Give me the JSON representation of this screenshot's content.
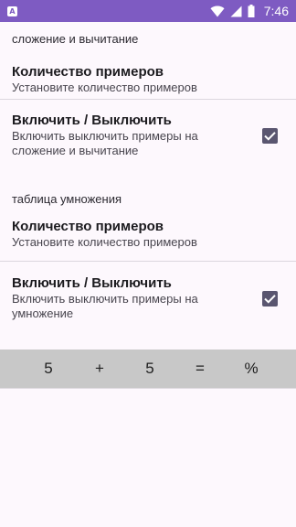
{
  "status_bar": {
    "notification_icon_letter": "A",
    "time": "7:46",
    "icons": [
      "wifi-icon",
      "cellular-signal-icon",
      "battery-icon"
    ],
    "bar_color": "#7e5bc2"
  },
  "sections": [
    {
      "category": "сложение и вычитание",
      "count_pref": {
        "title": "Количество примеров",
        "summary": "Установите количество примеров"
      },
      "toggle_pref": {
        "title": "Включить / Выключить",
        "summary": "Включить выключить примеры на сложение и вычитание",
        "checked": true
      }
    },
    {
      "category": "таблица умножения",
      "count_pref": {
        "title": "Количество примеров",
        "summary": "Установите количество примеров"
      },
      "toggle_pref": {
        "title": "Включить / Выключить",
        "summary": "Включить выключить примеры на умножение",
        "checked": true
      }
    }
  ],
  "expression_bar": {
    "operand1": "5",
    "operator": "+",
    "operand2": "5",
    "equals": "=",
    "result": "%"
  },
  "colors": {
    "checkbox": "#5a5670",
    "expression_bar_bg": "#c8c8c8",
    "background": "#fdf8fd"
  }
}
